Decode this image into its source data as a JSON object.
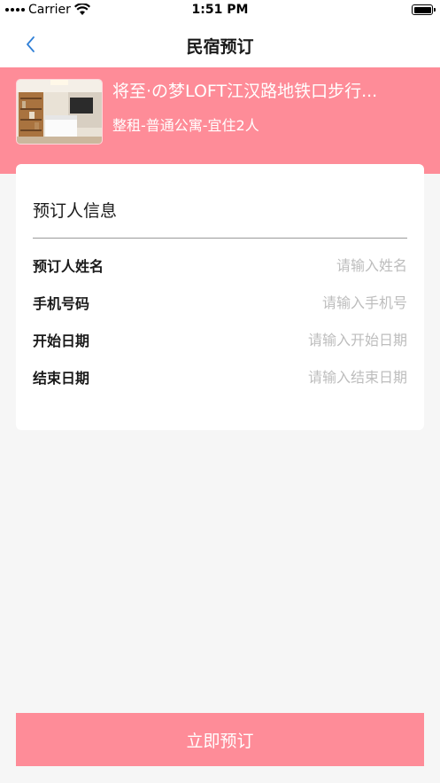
{
  "status_bar": {
    "carrier": "Carrier",
    "time": "1:51 PM"
  },
  "nav": {
    "title": "民宿预订",
    "back_icon": "chevron-left-icon"
  },
  "listing": {
    "title": "将至·の梦LOFT江汉路地铁口步行...",
    "subtitle": "整租-普通公寓-宜住2人"
  },
  "form": {
    "section_title": "预订人信息",
    "fields": [
      {
        "label": "预订人姓名",
        "placeholder": "请输入姓名",
        "value": ""
      },
      {
        "label": "手机号码",
        "placeholder": "请输入手机号",
        "value": ""
      },
      {
        "label": "开始日期",
        "placeholder": "请输入开始日期",
        "value": ""
      },
      {
        "label": "结束日期",
        "placeholder": "请输入结束日期",
        "value": ""
      }
    ]
  },
  "actions": {
    "book_label": "立即预订"
  },
  "colors": {
    "accent": "#fe8c98",
    "background": "#f6f6f6",
    "back_icon": "#2f7fd6"
  }
}
